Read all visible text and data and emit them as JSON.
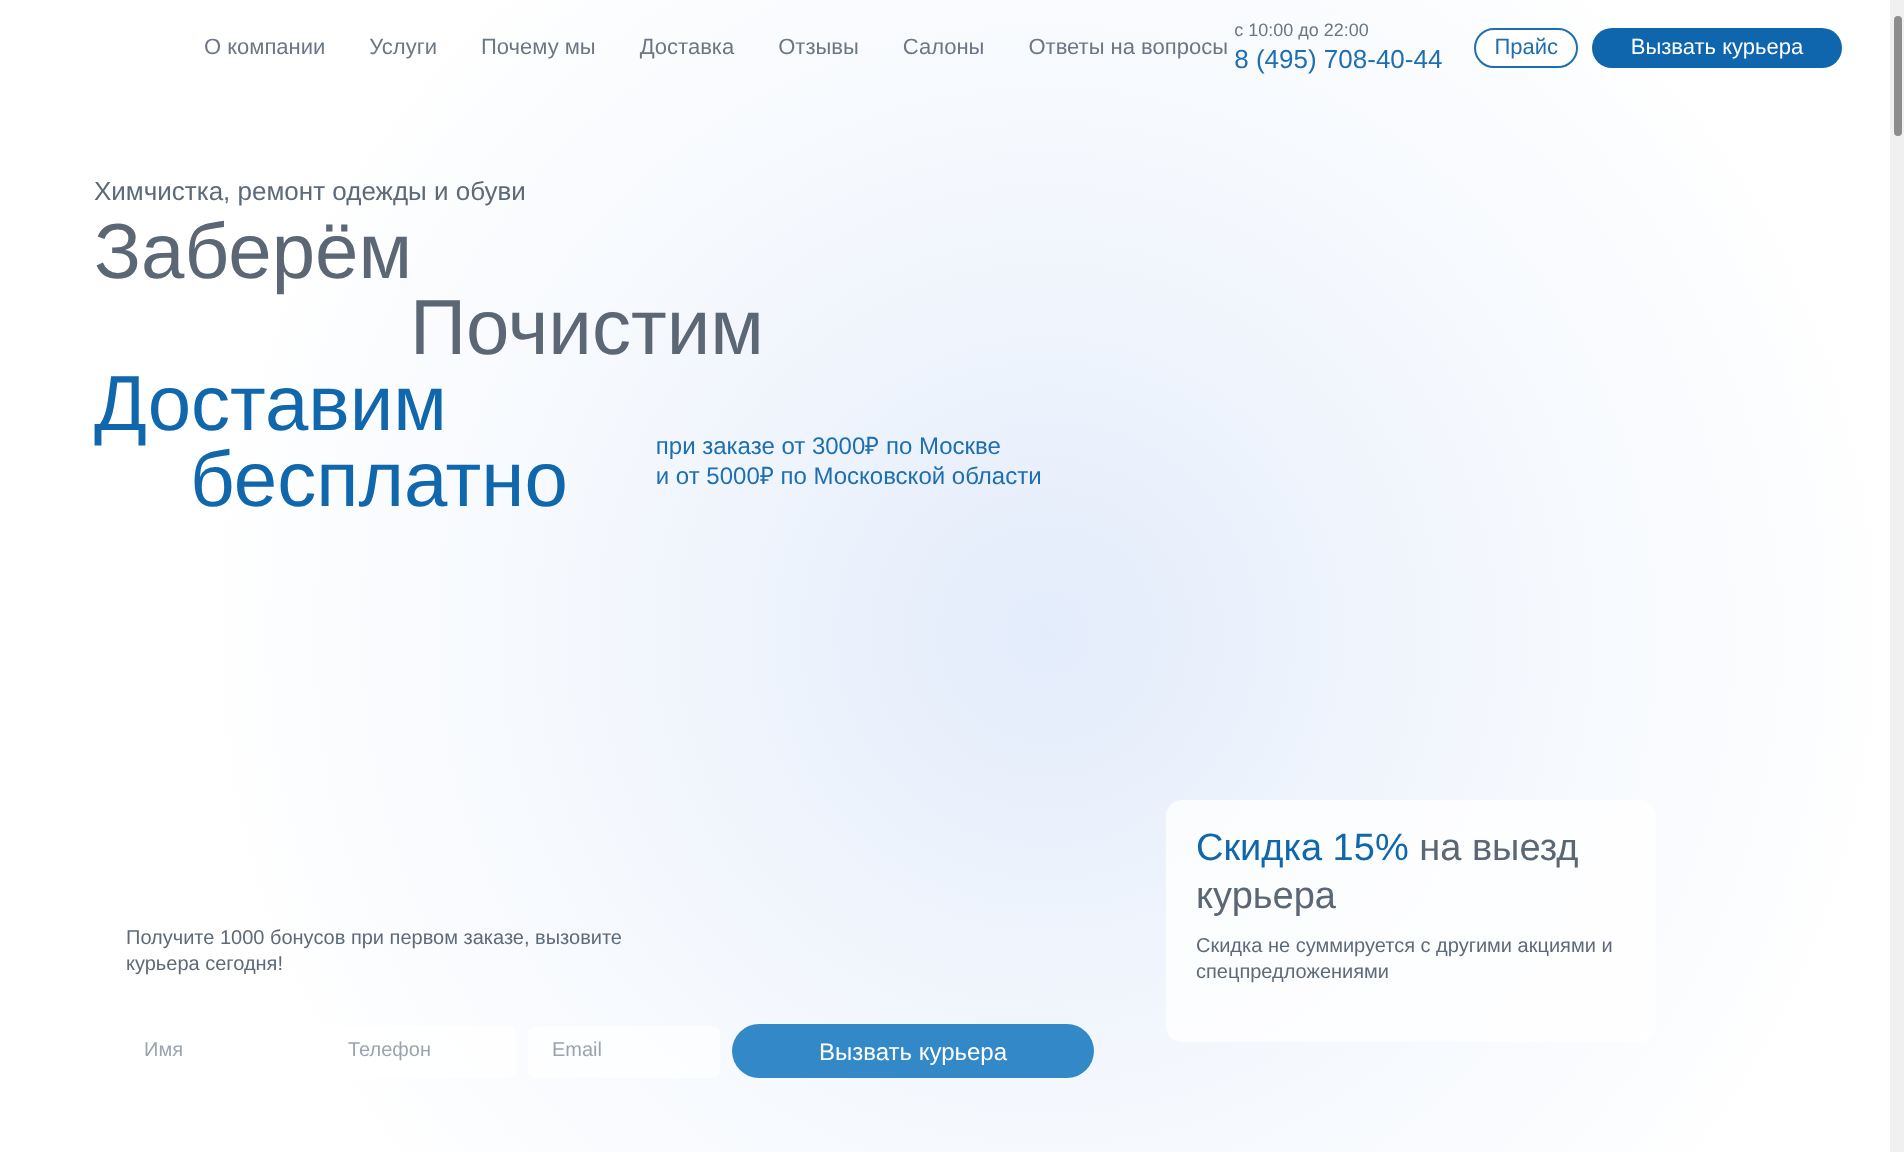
{
  "nav": {
    "items": [
      {
        "label": "О компании"
      },
      {
        "label": "Услуги"
      },
      {
        "label": "Почему мы"
      },
      {
        "label": "Доставка"
      },
      {
        "label": "Отзывы"
      },
      {
        "label": "Салоны"
      },
      {
        "label": "Ответы на вопросы"
      }
    ]
  },
  "contact": {
    "hours": "с 10:00 до 22:00",
    "phone": "8 (495) 708-40-44"
  },
  "header_buttons": [
    {
      "label": "Прайс",
      "kind": "outline"
    },
    {
      "label": "Вызвать курьера",
      "kind": "solid"
    }
  ],
  "hero": {
    "subtitle": "Химчистка, ремонт одежды и обуви",
    "lines": [
      {
        "text": "Заберём",
        "kind": "gray"
      },
      {
        "text": "Почистим",
        "kind": "gray"
      },
      {
        "text": "Доставим",
        "kind": "blue"
      },
      {
        "text": "бесплатно",
        "kind": "blue"
      }
    ],
    "note": [
      "при заказе от 3000₽ по Москве",
      "и от 5000₽ по Московской области"
    ]
  },
  "form": {
    "text": "Получите 1000 бонусов при первом заказе, вызовите курьера сегодня!",
    "fields": [
      {
        "placeholder": "Имя"
      },
      {
        "placeholder": "Телефон"
      },
      {
        "placeholder": "Email"
      }
    ],
    "button": "Вызвать курьера"
  },
  "promo": {
    "highlight": "Скидка 15%",
    "title_rest": "на выезд курьера",
    "text": "Скидка не суммируется с другими акциями и спецпредложениями"
  }
}
